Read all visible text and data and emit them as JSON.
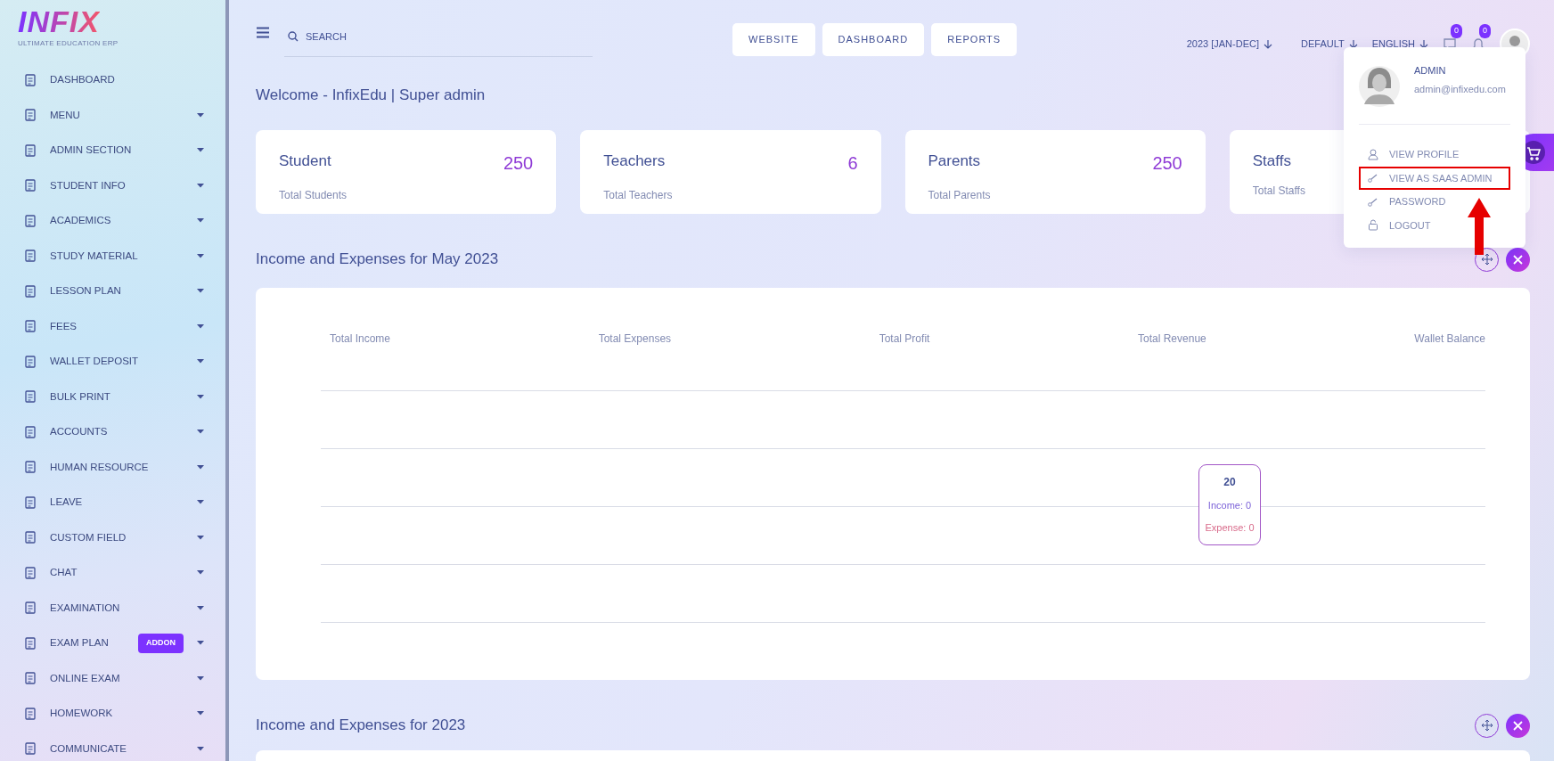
{
  "logo": {
    "text": "INFIX",
    "tagline": "ULTIMATE EDUCATION ERP"
  },
  "sidebar": {
    "items": [
      {
        "label": "DASHBOARD",
        "expandable": false
      },
      {
        "label": "MENU",
        "expandable": true
      },
      {
        "label": "ADMIN SECTION",
        "expandable": true
      },
      {
        "label": "STUDENT INFO",
        "expandable": true
      },
      {
        "label": "ACADEMICS",
        "expandable": true
      },
      {
        "label": "STUDY MATERIAL",
        "expandable": true
      },
      {
        "label": "LESSON PLAN",
        "expandable": true
      },
      {
        "label": "FEES",
        "expandable": true
      },
      {
        "label": "WALLET DEPOSIT",
        "expandable": true
      },
      {
        "label": "BULK PRINT",
        "expandable": true
      },
      {
        "label": "ACCOUNTS",
        "expandable": true
      },
      {
        "label": "HUMAN RESOURCE",
        "expandable": true
      },
      {
        "label": "LEAVE",
        "expandable": true
      },
      {
        "label": "CUSTOM FIELD",
        "expandable": true
      },
      {
        "label": "CHAT",
        "expandable": true
      },
      {
        "label": "EXAMINATION",
        "expandable": true
      },
      {
        "label": "EXAM PLAN",
        "expandable": true,
        "badge": "ADDON"
      },
      {
        "label": "ONLINE EXAM",
        "expandable": true
      },
      {
        "label": "HOMEWORK",
        "expandable": true
      },
      {
        "label": "COMMUNICATE",
        "expandable": true
      }
    ]
  },
  "search": {
    "placeholder": "SEARCH"
  },
  "nav_buttons": [
    "WEBSITE",
    "DASHBOARD",
    "REPORTS"
  ],
  "selectors": [
    "2023 [JAN-DEC]",
    "DEFAULT",
    "ENGLISH"
  ],
  "chat_count": "0",
  "notification_count": "0",
  "welcome": "Welcome - InfixEdu | Super admin",
  "stats": [
    {
      "title": "Student",
      "value": "250",
      "caption": "Total Students"
    },
    {
      "title": "Teachers",
      "value": "6",
      "caption": "Total Teachers"
    },
    {
      "title": "Parents",
      "value": "250",
      "caption": "Total Parents"
    },
    {
      "title": "Staffs",
      "caption": "Total Staffs"
    }
  ],
  "panels": [
    {
      "title": "Income and Expenses for May 2023",
      "legend": [
        "Total Income",
        "Total Expenses",
        "Total Profit",
        "Total Revenue",
        "Wallet Balance"
      ],
      "tooltip": {
        "title": "20",
        "income": "Income: 0",
        "expense": "Expense: 0"
      }
    },
    {
      "title": "Income and Expenses for 2023"
    }
  ],
  "profile_menu": {
    "name": "ADMIN",
    "email": "admin@infixedu.com",
    "items": [
      {
        "label": "VIEW PROFILE",
        "kind": "person",
        "highlighted": false
      },
      {
        "label": "VIEW AS SAAS ADMIN",
        "kind": "key",
        "highlighted": true
      },
      {
        "label": "PASSWORD",
        "kind": "key",
        "highlighted": false
      },
      {
        "label": "LOGOUT",
        "kind": "lock",
        "highlighted": false
      }
    ]
  }
}
